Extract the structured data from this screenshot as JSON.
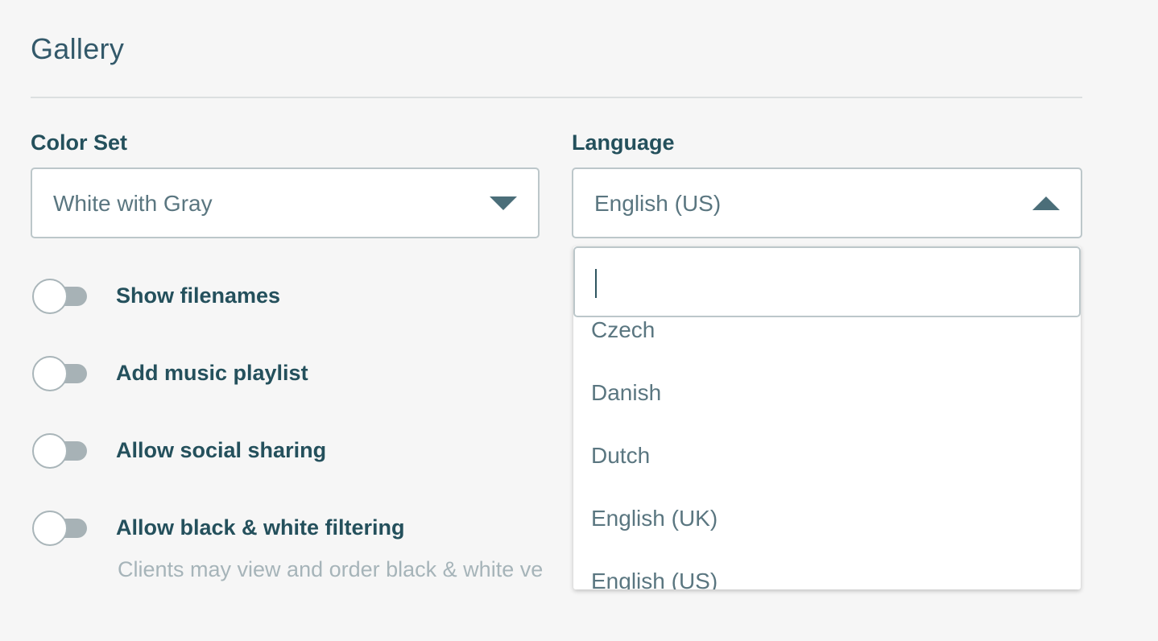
{
  "section": {
    "title": "Gallery"
  },
  "color_set": {
    "label": "Color Set",
    "value": "White with Gray"
  },
  "language": {
    "label": "Language",
    "value": "English (US)",
    "search_value": "",
    "options": [
      "Czech",
      "Danish",
      "Dutch",
      "English (UK)",
      "English (US)"
    ]
  },
  "toggles": [
    {
      "label": "Show filenames",
      "on": false
    },
    {
      "label": "Add music playlist",
      "on": false
    },
    {
      "label": "Allow social sharing",
      "on": false
    },
    {
      "label": "Allow black & white filtering",
      "on": false
    }
  ],
  "bw_filter_help": "Clients may view and order black & white ve",
  "colors": {
    "background": "#f6f6f6",
    "text_primary": "#24505c",
    "text_muted": "#a6b4b9",
    "border": "#bcc7ca",
    "toggle_off": "#a7b2b6"
  },
  "icons": {
    "color_set_caret": "chevron-down-icon",
    "language_caret": "chevron-up-icon"
  }
}
